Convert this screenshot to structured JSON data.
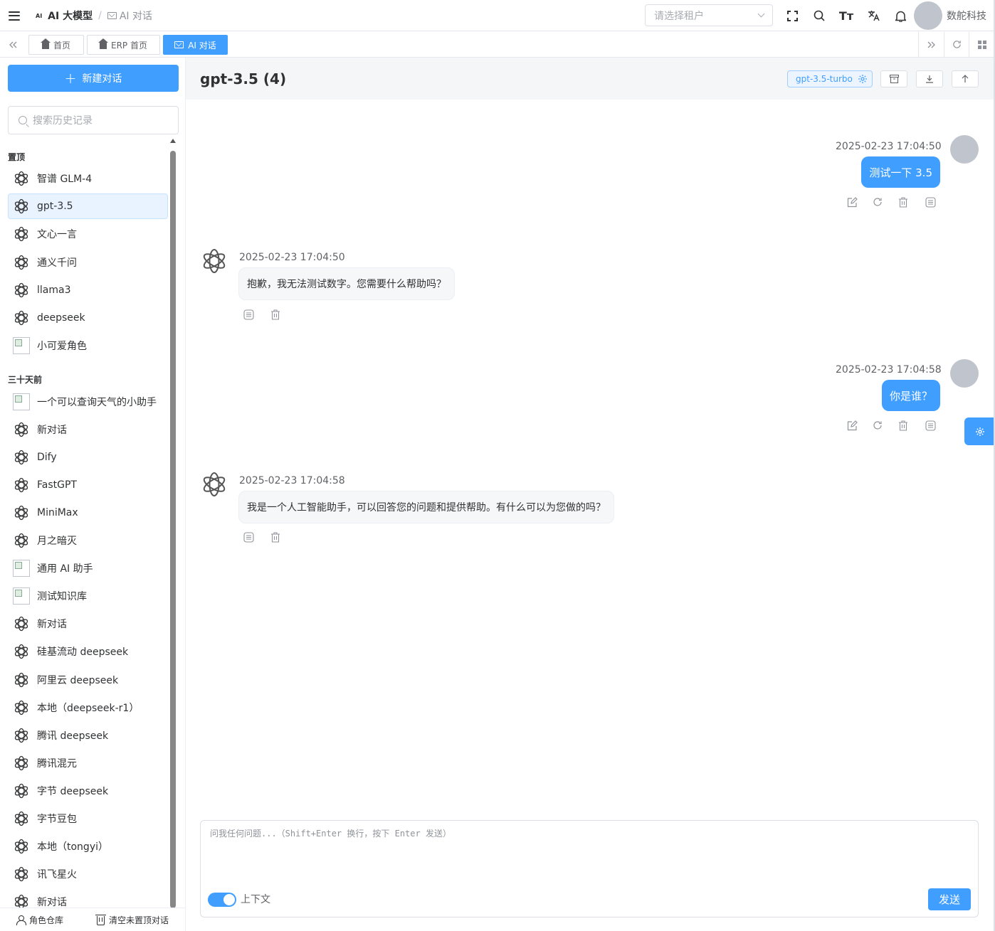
{
  "navbar": {
    "breadcrumb_logo": "AI",
    "breadcrumb_current": "AI 大模型",
    "breadcrumb_sep": "/",
    "breadcrumb_last": "AI 对话",
    "tenant_placeholder": "请选择租户",
    "font_size_label": "Tт",
    "user_name": "数舵科技"
  },
  "tags": [
    {
      "label": "首页",
      "icon": "home-icon",
      "active": false
    },
    {
      "label": "ERP 首页",
      "icon": "home-icon",
      "active": false
    },
    {
      "label": "AI 对话",
      "icon": "mail-icon",
      "active": true
    }
  ],
  "sidebar": {
    "new_chat_label": "新建对话",
    "search_placeholder": "搜索历史记录",
    "pinned_title": "置顶",
    "pinned": [
      {
        "label": "智谱 GLM-4",
        "icon": "openai-icon",
        "active": false
      },
      {
        "label": "gpt-3.5",
        "icon": "openai-icon",
        "active": true
      },
      {
        "label": "文心一言",
        "icon": "openai-icon",
        "active": false
      },
      {
        "label": "通义千问",
        "icon": "openai-icon",
        "active": false
      },
      {
        "label": "llama3",
        "icon": "openai-icon",
        "active": false
      },
      {
        "label": "deepseek",
        "icon": "openai-icon",
        "active": false
      },
      {
        "label": "小可爱角色",
        "icon": "broken-image-icon",
        "active": false
      }
    ],
    "older_title": "三十天前",
    "older": [
      {
        "label": "一个可以查询天气的小助手",
        "icon": "broken-image-icon"
      },
      {
        "label": "新对话",
        "icon": "openai-icon"
      },
      {
        "label": "Dify",
        "icon": "openai-icon"
      },
      {
        "label": "FastGPT",
        "icon": "openai-icon"
      },
      {
        "label": "MiniMax",
        "icon": "openai-icon"
      },
      {
        "label": "月之暗灭",
        "icon": "openai-icon"
      },
      {
        "label": "通用 AI 助手",
        "icon": "broken-image-icon"
      },
      {
        "label": "测试知识库",
        "icon": "broken-image-icon"
      },
      {
        "label": "新对话",
        "icon": "openai-icon"
      },
      {
        "label": "硅基流动 deepseek",
        "icon": "openai-icon"
      },
      {
        "label": "阿里云 deepseek",
        "icon": "openai-icon"
      },
      {
        "label": "本地（deepseek-r1）",
        "icon": "openai-icon"
      },
      {
        "label": "腾讯 deepseek",
        "icon": "openai-icon"
      },
      {
        "label": "腾讯混元",
        "icon": "openai-icon"
      },
      {
        "label": "字节 deepseek",
        "icon": "openai-icon"
      },
      {
        "label": "字节豆包",
        "icon": "openai-icon"
      },
      {
        "label": "本地（tongyi）",
        "icon": "openai-icon"
      },
      {
        "label": "讯飞星火",
        "icon": "openai-icon"
      },
      {
        "label": "新对话",
        "icon": "openai-icon"
      }
    ],
    "footer_role_label": "角色仓库",
    "footer_clear_label": "清空未置顶对话"
  },
  "chat": {
    "title": "gpt-3.5 (4)",
    "model": "gpt-3.5-turbo",
    "messages": [
      {
        "role": "user",
        "time": "2025-02-23 17:04:50",
        "text": "测试一下 3.5"
      },
      {
        "role": "assistant",
        "time": "2025-02-23 17:04:50",
        "text": "抱歉，我无法测试数字。您需要什么帮助吗？"
      },
      {
        "role": "user",
        "time": "2025-02-23 17:04:58",
        "text": "你是谁？"
      },
      {
        "role": "assistant",
        "time": "2025-02-23 17:04:58",
        "text": "我是一个人工智能助手，可以回答您的问题和提供帮助。有什么可以为您做的吗？"
      }
    ],
    "input_placeholder": "问我任何问题...（Shift+Enter 换行，按下 Enter 发送）",
    "context_label": "上下文",
    "context_enabled": true,
    "send_label": "发送"
  },
  "colors": {
    "primary": "#409eff",
    "text": "#303133",
    "muted": "#909399"
  }
}
